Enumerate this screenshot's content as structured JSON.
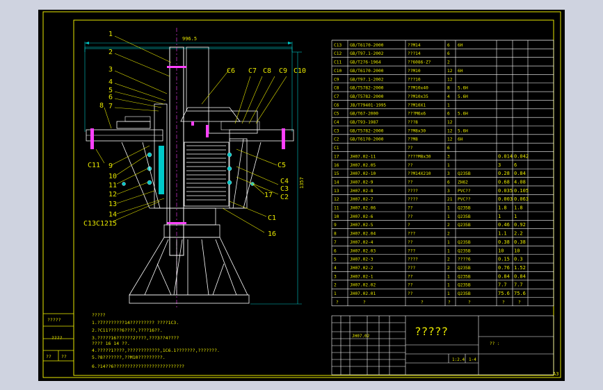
{
  "drawing": {
    "title": "?????",
    "dimensions": {
      "width": "996.5",
      "height": "1357"
    },
    "callouts": [
      "1",
      "2",
      "3",
      "4",
      "5",
      "6",
      "7",
      "8",
      "9",
      "10",
      "11",
      "12",
      "13",
      "14",
      "15",
      "16",
      "17",
      "C1",
      "C2",
      "C3",
      "C4",
      "C5",
      "C6",
      "C7",
      "C8",
      "C9",
      "C10",
      "C11",
      "C12",
      "C13"
    ],
    "corner_label": "A3"
  },
  "bom": [
    {
      "no": "C13",
      "code": "GB/T6170-2000",
      "name": "??M14",
      "qty": "6",
      "material": "6H",
      "w1": "",
      "w2": ""
    },
    {
      "no": "C12",
      "code": "GB/T97.1-2002",
      "name": "???14",
      "qty": "6",
      "material": "",
      "w1": "",
      "w2": ""
    },
    {
      "no": "C11",
      "code": "GB/T276-1964",
      "name": "??6086-Z?",
      "qty": "2",
      "material": "",
      "w1": "",
      "w2": ""
    },
    {
      "no": "C10",
      "code": "GB/T6170-2000",
      "name": "??M10",
      "qty": "12",
      "material": "6H",
      "w1": "",
      "w2": ""
    },
    {
      "no": "C9",
      "code": "GB/T97.1-2002",
      "name": "???10",
      "qty": "12",
      "material": "",
      "w1": "",
      "w2": ""
    },
    {
      "no": "C8",
      "code": "GB/T5782-2000",
      "name": "??M10x40",
      "qty": "8",
      "material": "5.6H",
      "w1": "",
      "w2": ""
    },
    {
      "no": "C7",
      "code": "GB/T5782-2000",
      "name": "??M10x35",
      "qty": "4",
      "material": "5.6H",
      "w1": "",
      "w2": ""
    },
    {
      "no": "C6",
      "code": "JB/T79401-1995",
      "name": "??M10X1",
      "qty": "1",
      "material": "",
      "w1": "",
      "w2": ""
    },
    {
      "no": "C5",
      "code": "GB/T67-2000",
      "name": "???M6x6",
      "qty": "6",
      "material": "5.6H",
      "w1": "",
      "w2": ""
    },
    {
      "no": "C4",
      "code": "GB/T93-1987",
      "name": "???8",
      "qty": "12",
      "material": "",
      "w1": "",
      "w2": ""
    },
    {
      "no": "C3",
      "code": "GB/T5782-2000",
      "name": "??M8x30",
      "qty": "12",
      "material": "5.6H",
      "w1": "",
      "w2": ""
    },
    {
      "no": "C2",
      "code": "GB/T6170-2000",
      "name": "??M8",
      "qty": "12",
      "material": "6H",
      "w1": "",
      "w2": ""
    },
    {
      "no": "C1",
      "code": "",
      "name": "??",
      "qty": "6",
      "material": "",
      "w1": "",
      "w2": ""
    },
    {
      "no": "17",
      "code": "JH07.02-11",
      "name": "????M8x30",
      "qty": "3",
      "material": "",
      "w1": "0.014",
      "w2": "0.042"
    },
    {
      "no": "16",
      "code": "JH07.02.05",
      "name": "??",
      "qty": "1",
      "material": "",
      "w1": "3",
      "w2": "6"
    },
    {
      "no": "15",
      "code": "JH07.02-10",
      "name": "??M14X210",
      "qty": "3",
      "material": "Q235B",
      "w1": "0.28",
      "w2": "0.84"
    },
    {
      "no": "14",
      "code": "JH07.02-9",
      "name": "??",
      "qty": "6",
      "material": "ZH62",
      "w1": "0.68",
      "w2": "4.08"
    },
    {
      "no": "13",
      "code": "JH07.02-8",
      "name": "????",
      "qty": "3",
      "material": "PVC??",
      "w1": "0.035",
      "w2": "0.105"
    },
    {
      "no": "12",
      "code": "JH07.02-7",
      "name": "????",
      "qty": "21",
      "material": "PVC??",
      "w1": "0.003",
      "w2": "0.063"
    },
    {
      "no": "11",
      "code": "JH07.02.06",
      "name": "??",
      "qty": "1",
      "material": "Q235B",
      "w1": "1.8",
      "w2": "1.8"
    },
    {
      "no": "10",
      "code": "JH07.02-6",
      "name": "??",
      "qty": "1",
      "material": "Q235B",
      "w1": "1",
      "w2": "1"
    },
    {
      "no": "9",
      "code": "JH07.02-5",
      "name": "?",
      "qty": "2",
      "material": "Q235B",
      "w1": "0.46",
      "w2": "0.92"
    },
    {
      "no": "8",
      "code": "JH07.02.04",
      "name": "???",
      "qty": "2",
      "material": "",
      "w1": "1.1",
      "w2": "2.2"
    },
    {
      "no": "7",
      "code": "JH07.02-4",
      "name": "??",
      "qty": "1",
      "material": "Q235B",
      "w1": "0.38",
      "w2": "0.38"
    },
    {
      "no": "6",
      "code": "JH07.02.03",
      "name": "???",
      "qty": "1",
      "material": "Q235B",
      "w1": "10",
      "w2": "10"
    },
    {
      "no": "5",
      "code": "JH07.02-3",
      "name": "????",
      "qty": "2",
      "material": "????6",
      "w1": "0.15",
      "w2": "0.3"
    },
    {
      "no": "4",
      "code": "JH07.02-2",
      "name": "???",
      "qty": "2",
      "material": "Q235B",
      "w1": "0.76",
      "w2": "1.52"
    },
    {
      "no": "3",
      "code": "JH07.02-1",
      "name": "??",
      "qty": "1",
      "material": "Q235B",
      "w1": "0.84",
      "w2": "0.84"
    },
    {
      "no": "2",
      "code": "JH07.02.02",
      "name": "??",
      "qty": "1",
      "material": "Q235B",
      "w1": "7.7",
      "w2": "7.7"
    },
    {
      "no": "1",
      "code": "JH07.02.01",
      "name": "??",
      "qty": "1",
      "material": "Q235B",
      "w1": "75.6",
      "w2": "75.6"
    }
  ],
  "bom_header": {
    "no": "?",
    "code": "?",
    "name": "?",
    "qty": "?",
    "material": "?",
    "w1": "?",
    "w2": "?"
  },
  "notes": {
    "heading": "?????",
    "lines": [
      "1.?7????????14????????? ????1C3.",
      "2.?C11?????6????,????16??.",
      "3.?????16??????2????,???3??4????",
      "   ????  16  14      ??.",
      "4.?????1????,????????????,1C6.1???????,???????.",
      "5.?8???????,??M10?????????.",
      "6.?14??6??????????????????????????"
    ]
  },
  "left_box": [
    "?????",
    "????",
    "??",
    "??"
  ],
  "title_block": {
    "name": "?????",
    "scale": "1:2.4",
    "sheet": "1-4",
    "small": "?? :",
    "code": "JH07.02"
  }
}
